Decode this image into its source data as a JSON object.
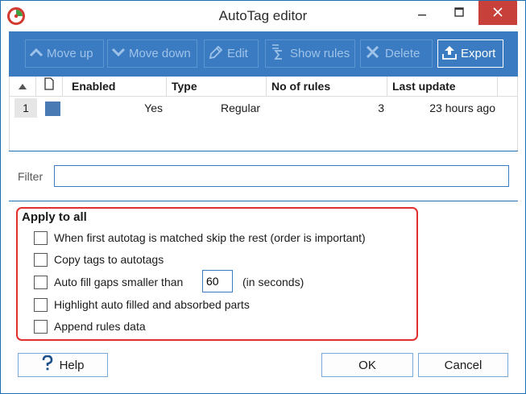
{
  "window": {
    "title": "AutoTag editor"
  },
  "toolbar": {
    "move_up": "Move up",
    "move_down": "Move down",
    "edit": "Edit",
    "show_rules": "Show rules",
    "delete": "Delete",
    "export": "Export"
  },
  "grid": {
    "columns": [
      "Enabled",
      "Type",
      "No of rules",
      "Last update"
    ],
    "rows": [
      {
        "index": "1",
        "color": "#4a7ab3",
        "enabled": "Yes",
        "type": "Regular",
        "rules": "3",
        "last_update": "23 hours ago"
      }
    ]
  },
  "filter": {
    "label": "Filter",
    "value": ""
  },
  "apply": {
    "title": "Apply to all",
    "opt_skip": "When first autotag is matched skip the rest (order is important)",
    "opt_copy": "Copy tags to autotags",
    "opt_fill": "Auto fill gaps smaller than",
    "fill_value": "60",
    "fill_unit": "(in seconds)",
    "opt_highlight": "Highlight auto filled and absorbed parts",
    "opt_append": "Append rules data"
  },
  "buttons": {
    "help": "Help",
    "ok": "OK",
    "cancel": "Cancel"
  },
  "colors": {
    "toolbar": "#3b7bc2",
    "accent": "#1f6fb5",
    "highlight_box": "#e0302b",
    "close": "#c7403a"
  }
}
